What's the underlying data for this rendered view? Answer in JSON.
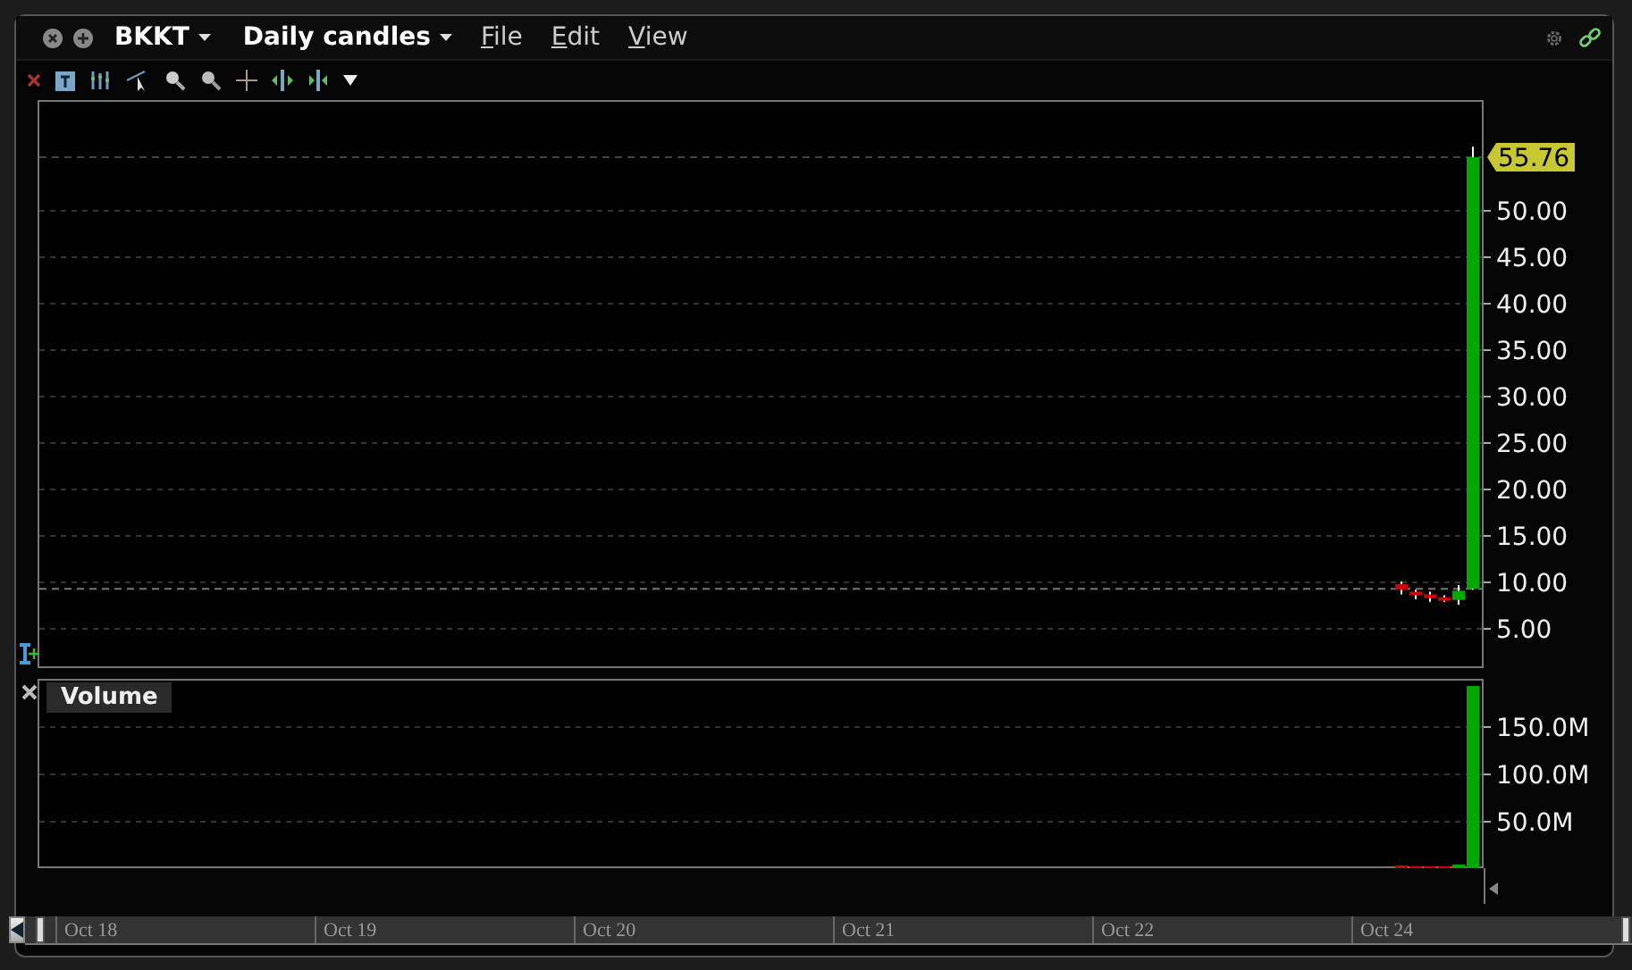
{
  "window": {
    "symbol": "BKKT",
    "period": "Daily candles",
    "menus": [
      "File",
      "Edit",
      "View"
    ]
  },
  "price_panel": {
    "last_price": "55.76",
    "axis_labels": [
      "50.00",
      "45.00",
      "40.00",
      "35.00",
      "30.00",
      "25.00",
      "20.00",
      "15.00",
      "10.00",
      "5.00"
    ]
  },
  "volume_panel": {
    "title": "Volume",
    "axis_labels": [
      "150.0M",
      "100.0M",
      "50.0M"
    ]
  },
  "time_axis": {
    "labels": [
      "Oct 18",
      "Oct 19",
      "Oct 20",
      "Oct 21",
      "Oct 22",
      "Oct 24"
    ]
  }
}
